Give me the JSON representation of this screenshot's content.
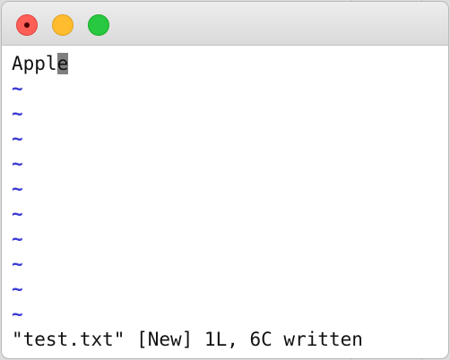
{
  "editor": {
    "text_before_cursor": "Appl",
    "cursor_char": "e",
    "empty_line_marker": "~",
    "empty_lines": 10,
    "status_message": "\"test.txt\" [New] 1L, 6C written"
  },
  "colors": {
    "tilde": "#3b3bd4",
    "cursor": "#7f7f7f",
    "close": "#ff5f57",
    "minimize": "#febc2e",
    "maximize": "#28c840"
  }
}
